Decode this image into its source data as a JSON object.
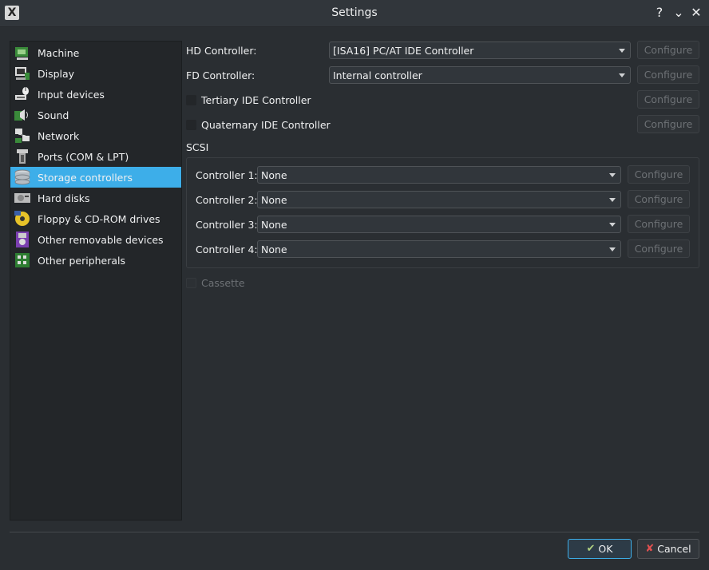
{
  "window": {
    "title": "Settings",
    "help_glyph": "?",
    "collapse_glyph": "⌄",
    "close_glyph": "✕",
    "app_icon_glyph": "X"
  },
  "sidebar": {
    "items": [
      {
        "label": "Machine",
        "icon": "machine-icon"
      },
      {
        "label": "Display",
        "icon": "display-icon"
      },
      {
        "label": "Input devices",
        "icon": "input-devices-icon"
      },
      {
        "label": "Sound",
        "icon": "sound-icon"
      },
      {
        "label": "Network",
        "icon": "network-icon"
      },
      {
        "label": "Ports (COM & LPT)",
        "icon": "ports-icon"
      },
      {
        "label": "Storage controllers",
        "icon": "storage-controllers-icon",
        "selected": true
      },
      {
        "label": "Hard disks",
        "icon": "hard-disks-icon"
      },
      {
        "label": "Floppy & CD-ROM drives",
        "icon": "floppy-cdrom-icon"
      },
      {
        "label": "Other removable devices",
        "icon": "removable-devices-icon"
      },
      {
        "label": "Other peripherals",
        "icon": "peripherals-icon"
      }
    ]
  },
  "main": {
    "hd_controller": {
      "label": "HD Controller:",
      "value": "[ISA16] PC/AT IDE Controller",
      "configure": "Configure"
    },
    "fd_controller": {
      "label": "FD Controller:",
      "value": "Internal controller",
      "configure": "Configure"
    },
    "tertiary_ide": {
      "label": "Tertiary IDE Controller",
      "checked": false,
      "configure": "Configure"
    },
    "quaternary_ide": {
      "label": "Quaternary IDE Controller",
      "checked": false,
      "configure": "Configure"
    },
    "scsi": {
      "title": "SCSI",
      "controllers": [
        {
          "label": "Controller 1:",
          "value": "None",
          "configure": "Configure"
        },
        {
          "label": "Controller 2:",
          "value": "None",
          "configure": "Configure"
        },
        {
          "label": "Controller 3:",
          "value": "None",
          "configure": "Configure"
        },
        {
          "label": "Controller 4:",
          "value": "None",
          "configure": "Configure"
        }
      ]
    },
    "cassette": {
      "label": "Cassette",
      "checked": false,
      "disabled": true
    }
  },
  "footer": {
    "ok": "OK",
    "cancel": "Cancel",
    "ok_icon": "✔",
    "cancel_icon": "✘"
  },
  "colors": {
    "selection": "#3daee9",
    "background": "#2a2e32",
    "sidebar": "#232629",
    "disabled_text": "#6d7175"
  }
}
